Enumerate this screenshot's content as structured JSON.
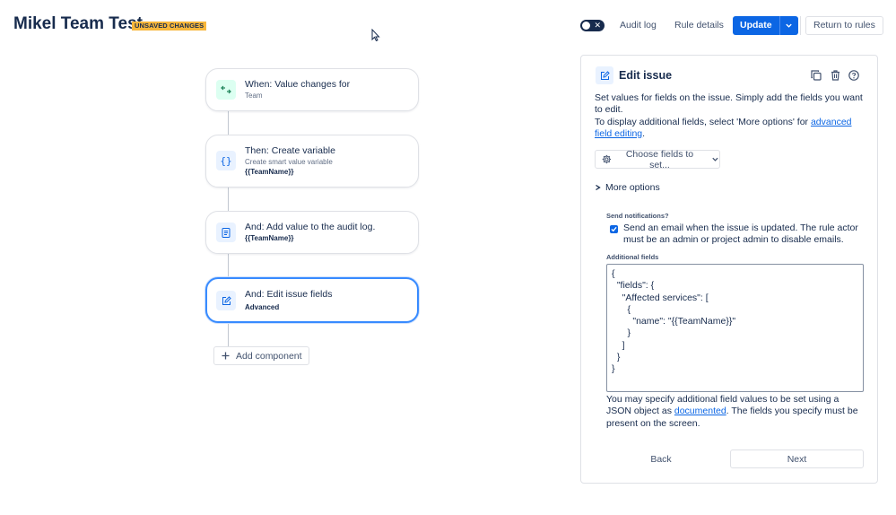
{
  "header": {
    "title": "Mikel Team Test",
    "badge": "UNSAVED CHANGES",
    "toggle_icon": "close-icon",
    "audit_log": "Audit log",
    "rule_details": "Rule details",
    "update": "Update",
    "return_to_rules": "Return to rules"
  },
  "flow": {
    "trigger": {
      "title": "When: Value changes for",
      "subtitle": "Team",
      "icon": "value-change-icon"
    },
    "step1": {
      "title": "Then: Create variable",
      "subtitle": "Create smart value variable",
      "detail": "{{TeamName}}",
      "icon": "braces-icon"
    },
    "step2": {
      "title": "And: Add value to the audit log.",
      "detail": "{{TeamName}}",
      "icon": "audit-log-icon"
    },
    "step3": {
      "title": "And: Edit issue fields",
      "detail": "Advanced",
      "icon": "edit-icon"
    },
    "add_component": "Add component"
  },
  "panel": {
    "title": "Edit issue",
    "description_1": "Set values for fields on the issue. Simply add the fields you want to edit.",
    "description_2": "To display additional fields, select 'More options' for ",
    "description_link": "advanced field editing",
    "description_end": ".",
    "choose_fields": "Choose fields to set...",
    "more_options": "More options",
    "send_notifications_label": "Send notifications?",
    "send_notifications_text": "Send an email when the issue is updated. The rule actor must be an admin or project admin to disable emails.",
    "send_notifications_checked": true,
    "additional_fields_label": "Additional fields",
    "additional_fields_value": "{\n  \"fields\": {\n    \"Affected services\": [\n      {\n        \"name\": \"{{TeamName}}\"\n      }\n    ]\n  }\n}",
    "help_1": "You may specify additional field values to be set using a JSON object as ",
    "help_link": "documented",
    "help_2": ". The fields you specify must be present on the screen.",
    "back": "Back",
    "next": "Next"
  },
  "colors": {
    "accent": "#0c66e4",
    "badge": "#f8b73b",
    "selected_border": "#388bff"
  }
}
